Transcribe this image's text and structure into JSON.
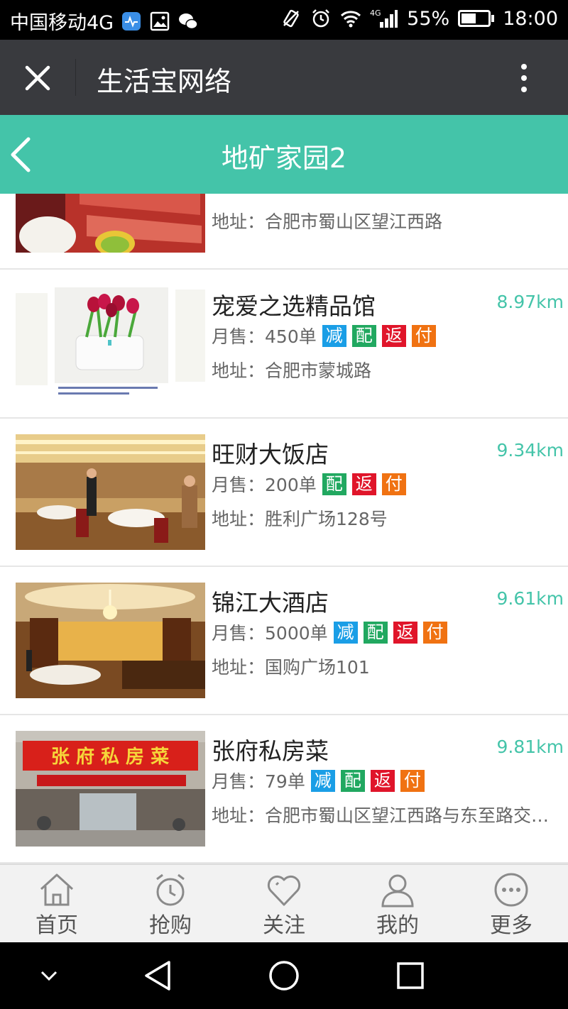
{
  "status_bar": {
    "carrier": "中国移动4G",
    "battery_percent_text": "55%",
    "battery_level": 0.55,
    "time": "18:00",
    "icons": [
      "health-icon",
      "image-icon",
      "wechat-icon",
      "vibrate-icon",
      "alarm-icon",
      "wifi-icon",
      "signal-4g-icon",
      "battery-icon"
    ]
  },
  "title_bar": {
    "title": "生活宝网络",
    "close_icon": "close-icon",
    "more_icon": "more-vertical-icon"
  },
  "header": {
    "title": "地矿家园2",
    "back_icon": "chevron-left-icon",
    "color": "#44c4a9"
  },
  "stores": [
    {
      "name": "",
      "distance": "",
      "sales_label": "",
      "sales_value": "",
      "badges": [],
      "address_label": "地址：",
      "address": "合肥市蜀山区望江西路"
    },
    {
      "name": "宠爱之选精品馆",
      "distance": "8.97km",
      "sales_label": "月售：",
      "sales_value": "450单",
      "badges": [
        "减",
        "配",
        "返",
        "付"
      ],
      "address_label": "地址：",
      "address": "合肥市蒙城路"
    },
    {
      "name": "旺财大饭店",
      "distance": "9.34km",
      "sales_label": "月售：",
      "sales_value": "200单",
      "badges": [
        "配",
        "返",
        "付"
      ],
      "address_label": "地址：",
      "address": "胜利广场128号"
    },
    {
      "name": "锦江大酒店",
      "distance": "9.61km",
      "sales_label": "月售：",
      "sales_value": "5000单",
      "badges": [
        "减",
        "配",
        "返",
        "付"
      ],
      "address_label": "地址：",
      "address": "国购广场101"
    },
    {
      "name": "张府私房菜",
      "distance": "9.81km",
      "sales_label": "月售：",
      "sales_value": "79单",
      "badges": [
        "减",
        "配",
        "返",
        "付"
      ],
      "address_label": "地址：",
      "address": "合肥市蜀山区望江西路与东至路交…",
      "sign_text": "张 府 私 房 菜"
    }
  ],
  "badge_colors": {
    "减": "#1a9ee6",
    "配": "#21a860",
    "返": "#e0152a",
    "付": "#f07212"
  },
  "tabs": [
    {
      "label": "首页",
      "icon": "home-icon"
    },
    {
      "label": "抢购",
      "icon": "alarm-clock-icon"
    },
    {
      "label": "关注",
      "icon": "heart-icon"
    },
    {
      "label": "我的",
      "icon": "user-icon"
    },
    {
      "label": "更多",
      "icon": "more-horizontal-icon"
    }
  ],
  "nav_bar": {
    "icons": [
      "chevron-down-icon",
      "back-triangle-icon",
      "home-circle-icon",
      "recents-square-icon"
    ]
  }
}
